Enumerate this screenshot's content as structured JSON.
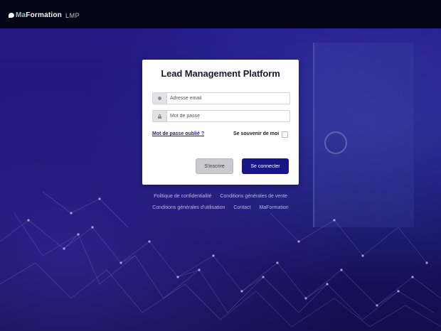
{
  "header": {
    "brand": {
      "name_prefix": "Ma",
      "name_rest": "Formation",
      "suffix": "LMP"
    }
  },
  "login": {
    "title": "Lead Management Platform",
    "email": {
      "placeholder": "Adresse email",
      "value": "",
      "icon": "at-icon"
    },
    "password": {
      "placeholder": "Mot de passe",
      "value": "",
      "icon": "lock-icon"
    },
    "forgot_password": "Mot de passe oublié ?",
    "remember_me": "Se souvenir de moi",
    "remember_checked": false,
    "register_label": "S'inscrire",
    "login_label": "Se connecter"
  },
  "footer": {
    "row1": [
      "Politique de confidentialité",
      "Conditions générales de vente"
    ],
    "row2": [
      "Conditions générales d'utilisation",
      "Contact",
      "MaFormation"
    ]
  },
  "colors": {
    "topbar": "#040414",
    "background": "#1f1878",
    "primary_button": "#1a1585",
    "link": "#1d1c8a",
    "brand_accent": "#7fd6b9"
  }
}
